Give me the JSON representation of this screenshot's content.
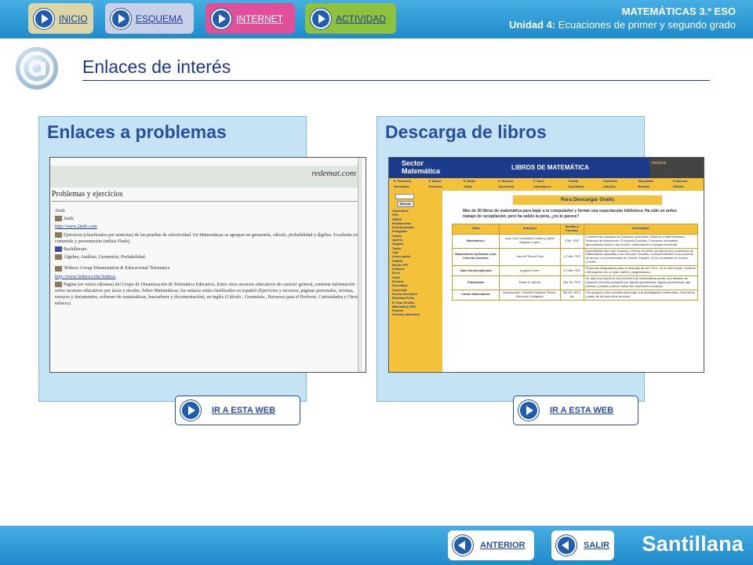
{
  "nav": {
    "inicio": "INICIO",
    "esquema": "ESQUEMA",
    "internet": "INTERNET",
    "actividad": "ACTIVIDAD"
  },
  "course": {
    "subject": "MATEMÁTICAS 3.º ESO",
    "unit_label": "Unidad 4:",
    "unit_title": "Ecuaciones de primer y segundo grado"
  },
  "page_title": "Enlaces de interés",
  "panels": {
    "left": {
      "title": "Enlaces a problemas",
      "link_label": "IR A ESTA WEB",
      "site": {
        "logo": "redemat.com",
        "heading": "Problemas y ejercicios",
        "items": [
          {
            "text": "2mdc"
          },
          {
            "text": "2mdc"
          },
          {
            "text": "http://www.2mdc.com",
            "link": true
          },
          {
            "text": "Ejercicios (clasificados por materias) de las pruebas de selectividad. En Matemáticas se agrupan en geometría, cálculo, probabilidad y álgebra. Excelente en contenido y presentación (utiliza Flash)."
          },
          {
            "text": "Bachillerato."
          },
          {
            "text": "Álgebra, Análisis, Geometría, Probabilidad."
          },
          {
            "text": "3Educa: Group Dinamization & Educacional Telematics"
          },
          {
            "text": "http://www.3educa.com/3educa/",
            "link": true
          },
          {
            "text": "Página (en varios idiomas) del Grupo de Dinamización de Telemática Educativa. Entre otros recursos educativos de carácter general, contiene información sobre recursos educativos por áreas y niveles. Sobre Matemáticas, los enlaces están clasificados en español (Ejercicios y recursos, páginas personales, revistas, ensayos y documentos, software de matemáticas, buscadores y documentación), en inglés (Cálculo , Geometría , Recursos para el Profesor, Curiosidades y Otros enlaces)."
          }
        ]
      }
    },
    "right": {
      "title": "Descarga de libros",
      "link_label": "IR A ESTA WEB",
      "site": {
        "brand_line1": "Sector",
        "brand_line2": "Matemática",
        "header_title": "LIBROS DE MATEMÁTICA",
        "ads": "músicos",
        "menu": [
          "E. Parvularia",
          "E. Básica",
          "E. Media",
          "E. Superior",
          "E. Rural",
          "Familia",
          "Geometría",
          "Olimpiadas",
          "Problemas",
          "Informática",
          "Proyectos",
          "Tablas",
          "Diccionario",
          "Calculadoras",
          "Sociedades",
          "Artículos",
          "Revistas",
          "Historia",
          "Biografías"
        ],
        "search_btn": "Buscar",
        "sidebar": [
          "Contenidos",
          "PSU",
          "SIMCE",
          "Evaluaciones",
          "Internacionales",
          "Fotografía",
          "Videos",
          "Ajedrez",
          "Origami",
          "Teatro",
          "Cine",
          "Libros gratis",
          "Pfaffdo",
          "Mundo PPT",
          "Software",
          "Excel",
          "Flash",
          "Eventos",
          "Recreativa",
          "Comercial",
          "Premio Escolares",
          "Medallas Fields",
          "El Gran Desafío",
          "Matemática 2000",
          "Enlaces",
          "Premios Obtenidos"
        ],
        "download_title": "Para Descargar Gratis",
        "intro": "Más de 30 libros de matemática para bajar a tu computador y formar una espectacular biblioteca. Ha sido un arduo trabajo de recopilación, pero ha valido la pena, ¿no te parece?",
        "table_headers": [
          "Título",
          "Autor(es)",
          "Tamaño y Formato",
          "Comentario"
        ],
        "rows": [
          [
            "Matemática I",
            "Juan Luis Covolaedo Cortes y Javier Marjuan López",
            "3 Mb. PDF",
            "Contiene las unidades de Espacios vectoriales, Matrices y determinantes, Sistemas de ecuaciones, El espacio Euclídeo, Funciones derivables, Aproximación local a una función, Interpolación e integral indefinida."
          ],
          [
            "Matemáticas Aplicadas a las Ciencias Sociales",
            "Jose Mª Rocali Tous",
            "1,2 Mb. PDF",
            "Especialistas libro que resuelve y ofrece resueltos los ejercicios y problemas de Matemáticas aplicadas a las Ciencias Sociales, correspondientes a las pruebas de acceso a la Universidad de Oviedo, España, en su modalidad de acceso LOGSE."
          ],
          [
            "Sala interdisciplinaria",
            "Angela Crochi",
            "2,9 Mb. PDF",
            "Proyectos integradores para el abordaje de los C.B.C. en el nivel inicial. Contiene 458 páginas con un gran diseño y diagramación."
          ],
          [
            "Planilandia",
            "Edwin A. Abbott",
            "424 Kb. PDF",
            "He aquí una aventura conmovedora de matemáticas puras, una fantasía de espacios extraños poblados por figuras geométricas: figuras geométricas que piensan y hablan y tienen todas las emociones humanas."
          ],
          [
            "Cartas Matemáticas",
            "Ilustraciones: Graciela Galliponi Textos: Eleonora Catrigeras",
            "780 Kb. DOC, zip",
            "Tres juegos y doce cuentos para jugar a la investigación matemática. Para niños a partir de los seis años de edad."
          ]
        ]
      }
    }
  },
  "footer": {
    "anterior": "ANTERIOR",
    "salir": "SALIR",
    "brand": "Santillana"
  },
  "colors": {
    "bar": "#2f9bd6",
    "panel": "#c6e3f6",
    "title": "#2a4e9e",
    "inicio": "#dcd6a6",
    "esquema": "#c8cfe8",
    "internet": "#e0509a",
    "actividad": "#8ec13d"
  }
}
